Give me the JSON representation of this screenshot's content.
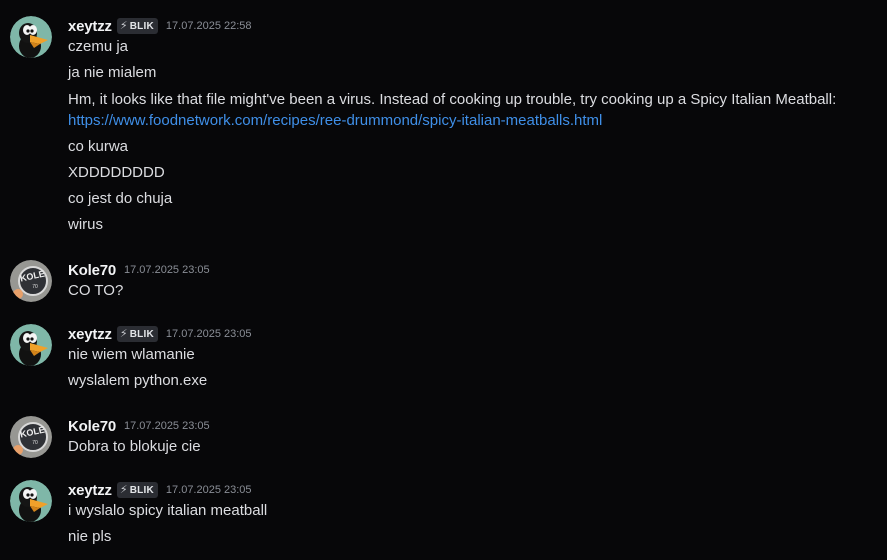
{
  "colors": {
    "background": "#070709",
    "text": "#dcdde1",
    "username": "#f2f3f5",
    "timestamp": "#8a8e96",
    "link": "#3f8fe8",
    "tag_background": "#2b2d33"
  },
  "icons": {
    "xeytzz_avatar": "daffy-duck-avatar",
    "kole70_avatar": "kole-logo-avatar",
    "tag_icon": "lightning-bolt-icon"
  },
  "messages": [
    {
      "author": "xeytzz",
      "tag": "BLIK",
      "tag_icon": "⚡",
      "timestamp": "17.07.2025 22:58",
      "lines": [
        "czemu ja",
        "ja nie mialem"
      ],
      "bot_reply": "Hm, it looks like that file might've been a virus. Instead of cooking up trouble, try cooking up a Spicy Italian Meatball:",
      "link": "https://www.foodnetwork.com/recipes/ree-drummond/spicy-italian-meatballs.html",
      "after": [
        "co kurwa",
        "XDDDDDDDD",
        "co jest do chuja",
        "wirus"
      ]
    },
    {
      "author": "Kole70",
      "timestamp": "17.07.2025 23:05",
      "lines": [
        "CO TO?"
      ]
    },
    {
      "author": "xeytzz",
      "tag": "BLIK",
      "tag_icon": "⚡",
      "timestamp": "17.07.2025 23:05",
      "lines": [
        "nie wiem wlamanie",
        "wyslalem python.exe"
      ]
    },
    {
      "author": "Kole70",
      "timestamp": "17.07.2025 23:05",
      "lines": [
        "Dobra to blokuje cie"
      ]
    },
    {
      "author": "xeytzz",
      "tag": "BLIK",
      "tag_icon": "⚡",
      "timestamp": "17.07.2025 23:05",
      "lines": [
        "i wyslalo spicy italian meatball",
        "nie pls"
      ]
    }
  ]
}
